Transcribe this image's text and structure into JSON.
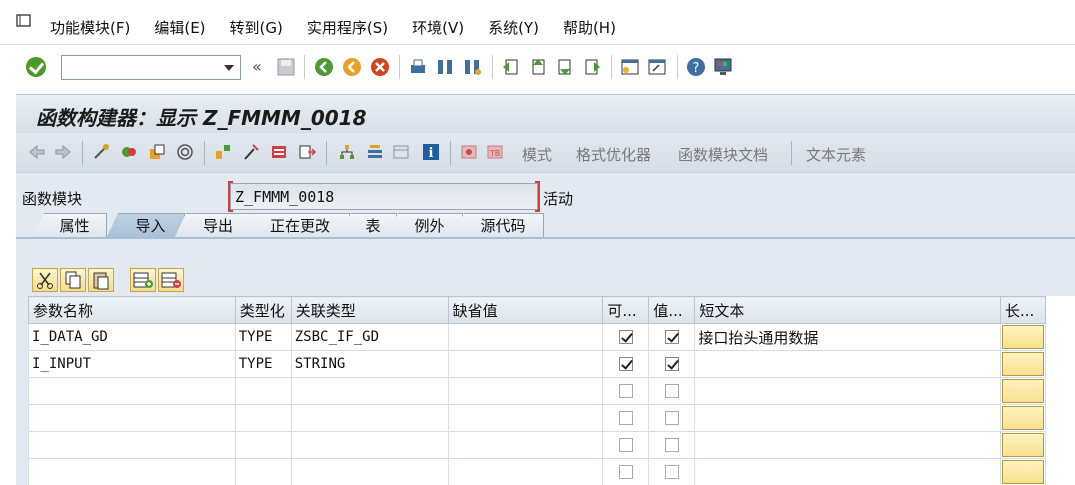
{
  "menu": [
    "功能模块(F)",
    "编辑(E)",
    "转到(G)",
    "实用程序(S)",
    "环境(V)",
    "系统(Y)",
    "帮助(H)"
  ],
  "title": "函数构建器：显示 Z_FMMM_0018",
  "app_toolbar": {
    "pattern": "模式",
    "pretty_printer": "格式优化器",
    "fm_doc": "函数模块文档",
    "text_elements": "文本元素"
  },
  "function_module": {
    "label": "函数模块",
    "value": "Z_FMMM_0018",
    "status": "活动"
  },
  "tabs": [
    {
      "label": "属性",
      "active": false
    },
    {
      "label": "导入",
      "active": true
    },
    {
      "label": "导出",
      "active": false
    },
    {
      "label": "正在更改",
      "active": false
    },
    {
      "label": "表",
      "active": false
    },
    {
      "label": "例外",
      "active": false
    },
    {
      "label": "源代码",
      "active": false
    }
  ],
  "table": {
    "headers": [
      "参数名称",
      "类型化",
      "关联类型",
      "缺省值",
      "可...",
      "值...",
      "短文本",
      "长..."
    ],
    "rows": [
      {
        "name": "I_DATA_GD",
        "typing": "TYPE",
        "assoc": "ZSBC_IF_GD",
        "default": "",
        "optional": true,
        "value": true,
        "short_text": "接口抬头通用数据"
      },
      {
        "name": "I_INPUT",
        "typing": "TYPE",
        "assoc": "STRING",
        "default": "",
        "optional": true,
        "value": true,
        "short_text": ""
      },
      {
        "name": "",
        "typing": "",
        "assoc": "",
        "default": "",
        "optional": false,
        "value": false,
        "short_text": ""
      },
      {
        "name": "",
        "typing": "",
        "assoc": "",
        "default": "",
        "optional": false,
        "value": false,
        "short_text": ""
      },
      {
        "name": "",
        "typing": "",
        "assoc": "",
        "default": "",
        "optional": false,
        "value": false,
        "short_text": ""
      },
      {
        "name": "",
        "typing": "",
        "assoc": "",
        "default": "",
        "optional": false,
        "value": false,
        "short_text": ""
      }
    ]
  }
}
